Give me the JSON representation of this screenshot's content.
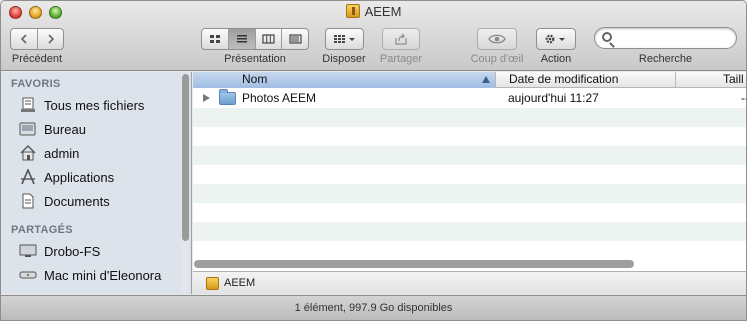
{
  "window": {
    "title": "AEEM",
    "title_icon": "usb-drive-icon"
  },
  "toolbar": {
    "back_label": "Précédent",
    "view_label": "Présentation",
    "arrange_label": "Disposer",
    "share_label": "Partager",
    "quicklook_label": "Coup d'œil",
    "action_label": "Action",
    "search_label": "Recherche",
    "search_value": "",
    "view_modes": [
      "icon-view",
      "list-view",
      "column-view",
      "coverflow-view"
    ],
    "active_view": "list-view"
  },
  "sidebar": {
    "favorites_heading": "FAVORIS",
    "favorites": [
      {
        "label": "Tous mes fichiers",
        "icon": "all-files-icon"
      },
      {
        "label": "Bureau",
        "icon": "desktop-icon"
      },
      {
        "label": "admin",
        "icon": "home-icon"
      },
      {
        "label": "Applications",
        "icon": "applications-icon"
      },
      {
        "label": "Documents",
        "icon": "documents-icon"
      }
    ],
    "shared_heading": "PARTAGÉS",
    "shared": [
      {
        "label": "Drobo-FS",
        "icon": "network-display-icon"
      },
      {
        "label": "Mac mini d'Eleonora",
        "icon": "mac-mini-icon"
      }
    ]
  },
  "file_list": {
    "columns": {
      "name": "Nom",
      "modified": "Date de modification",
      "size": "Taill"
    },
    "sorted_column": "name",
    "items": [
      {
        "name": "Photos AEEM",
        "modified": "aujourd'hui 11:27",
        "size": "--",
        "icon": "folder-icon"
      }
    ]
  },
  "pathbar": {
    "label": "AEEM"
  },
  "status": {
    "text": "1 élément, 997.9 Go disponibles"
  }
}
